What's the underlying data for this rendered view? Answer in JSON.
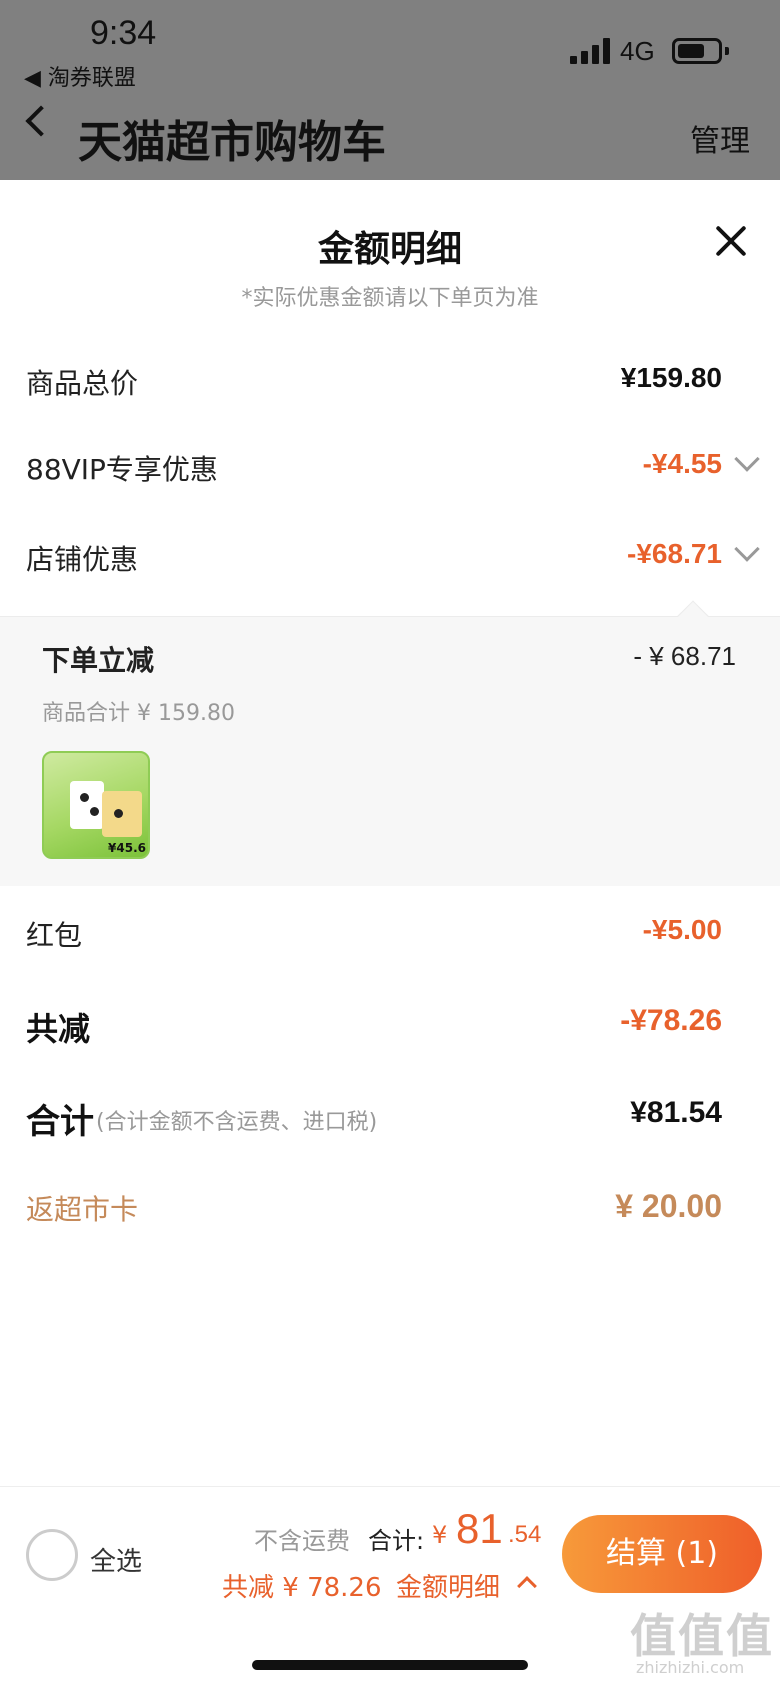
{
  "status": {
    "time": "9:34",
    "back_app": "◀ 淘券联盟",
    "network": "4G"
  },
  "nav": {
    "title": "天猫超市购物车",
    "manage": "管理"
  },
  "sheet": {
    "title": "金额明细",
    "subtitle": "*实际优惠金额请以下单页为准",
    "rows": {
      "goods_total": {
        "label": "商品总价",
        "value": "¥159.80"
      },
      "vip": {
        "label": "88VIP专享优惠",
        "value": "-¥4.55"
      },
      "shop": {
        "label": "店铺优惠",
        "value": "-¥68.71"
      },
      "red_packet": {
        "label": "红包",
        "value": "-¥5.00"
      },
      "total_reduce": {
        "label": "共减",
        "value": "-¥78.26"
      },
      "total": {
        "label": "合计",
        "note": "(合计金额不含运费、进口税)",
        "value": "¥81.54"
      },
      "return_card": {
        "label": "返超市卡",
        "value": "¥ 20.00"
      }
    },
    "shop_detail": {
      "title": "下单立减",
      "value": "- ¥ 68.71",
      "subtotal": "商品合计 ¥ 159.80",
      "thumb_price": "¥45.6"
    }
  },
  "bottom": {
    "select_all": "全选",
    "excl_shipping": "不含运费",
    "sum_label": "合计:",
    "sum_yen": "¥",
    "sum_int": "81",
    "sum_dec": ".54",
    "reduce": "共减 ¥ 78.26",
    "detail_link": "金额明细",
    "checkout": "结算 (1)"
  },
  "watermark": {
    "main": "值值值",
    "sub": "zhizhizhi.com"
  },
  "colors": {
    "accent": "#e8612c",
    "return": "#c58a5a"
  }
}
